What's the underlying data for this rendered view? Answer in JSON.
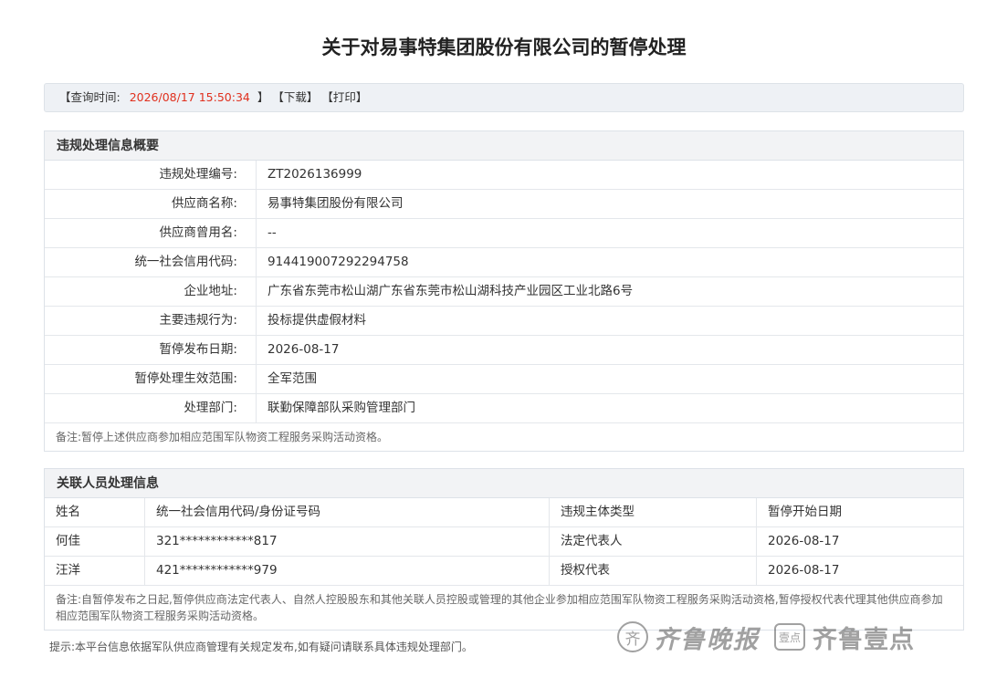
{
  "page_title": "关于对易事特集团股份有限公司的暂停处理",
  "query_bar": {
    "label": "【查询时间:",
    "time": "2026/08/17 15:50:34",
    "close": "】",
    "download": "【下载】",
    "print": "【打印】"
  },
  "violation_section": {
    "header": "违规处理信息概要",
    "rows": [
      {
        "label": "违规处理编号:",
        "value": "ZT2026136999"
      },
      {
        "label": "供应商名称:",
        "value": "易事特集团股份有限公司"
      },
      {
        "label": "供应商曾用名:",
        "value": "--"
      },
      {
        "label": "统一社会信用代码:",
        "value": "914419007292294758"
      },
      {
        "label": "企业地址:",
        "value": "广东省东莞市松山湖广东省东莞市松山湖科技产业园区工业北路6号"
      },
      {
        "label": "主要违规行为:",
        "value": "投标提供虚假材料"
      },
      {
        "label": "暂停发布日期:",
        "value": "2026-08-17"
      },
      {
        "label": "暂停处理生效范围:",
        "value": "全军范围"
      },
      {
        "label": "处理部门:",
        "value": "联勤保障部队采购管理部门"
      }
    ],
    "note": "备注:暂停上述供应商参加相应范围军队物资工程服务采购活动资格。"
  },
  "related_section": {
    "header": "关联人员处理信息",
    "columns": [
      "姓名",
      "统一社会信用代码/身份证号码",
      "违规主体类型",
      "暂停开始日期"
    ],
    "rows": [
      [
        "何佳",
        "321************817",
        "法定代表人",
        "2026-08-17"
      ],
      [
        "汪洋",
        "421************979",
        "授权代表",
        "2026-08-17"
      ]
    ],
    "note": "备注:自暂停发布之日起,暂停供应商法定代表人、自然人控股股东和其他关联人员控股或管理的其他企业参加相应范围军队物资工程服务采购活动资格,暂停授权代表代理其他供应商参加相应范围军队物资工程服务采购活动资格。"
  },
  "tip": "提示:本平台信息依据军队供应商管理有关规定发布,如有疑问请联系具体违规处理部门。",
  "watermark": {
    "circle_char": "齐",
    "text1": "齐鲁晚报",
    "badge": "壹点",
    "text2": "齐鲁壹点"
  }
}
